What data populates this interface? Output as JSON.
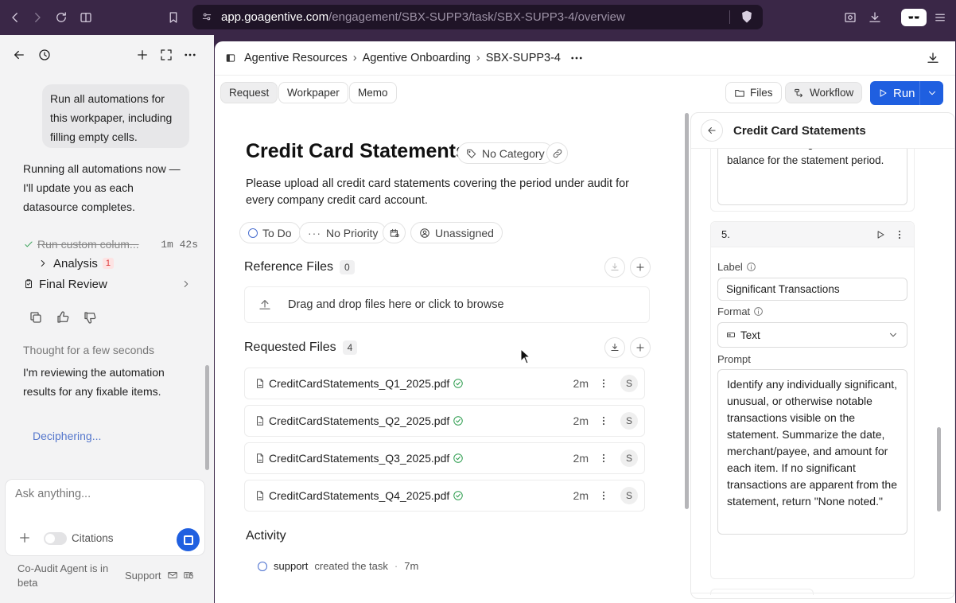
{
  "browser": {
    "url_domain": "app.goagentive.com",
    "url_path": "/engagement/SBX-SUPP3/task/SBX-SUPP3-4/overview"
  },
  "agent": {
    "user_message": "Run all automations for this workpaper, including filling empty cells.",
    "reply": "Running all automations now — I'll update you as each datasource completes.",
    "step_done": {
      "label": "Run custom colum...",
      "time": "1m 42s"
    },
    "analysis": {
      "label": "Analysis",
      "count": "1"
    },
    "final_review": "Final Review",
    "thought": "Thought for a few seconds",
    "reviewing": "I'm reviewing the automation results for any fixable items.",
    "status": "Deciphering...",
    "input_placeholder": "Ask anything...",
    "citations": "Citations",
    "beta_note": "Co-Audit Agent is in beta",
    "support": "Support"
  },
  "breadcrumb": {
    "items": [
      "Agentive Resources",
      "Agentive Onboarding",
      "SBX-SUPP3-4"
    ]
  },
  "tabs": [
    "Request",
    "Workpaper",
    "Memo"
  ],
  "toolbar": {
    "files": "Files",
    "workflow": "Workflow",
    "run": "Run"
  },
  "task": {
    "title": "Credit Card Statements",
    "category": "No Category",
    "description": "Please upload all credit card statements covering the period under audit for every company credit card account.",
    "status": "To Do",
    "priority": "No Priority",
    "assignee": "Unassigned"
  },
  "reference_files": {
    "title": "Reference Files",
    "count": "0",
    "dropzone": "Drag and drop files here or click to browse"
  },
  "requested_files": {
    "title": "Requested Files",
    "count": "4",
    "files": [
      {
        "name": "CreditCardStatements_Q1_2025.pdf",
        "age": "2m",
        "user": "S"
      },
      {
        "name": "CreditCardStatements_Q2_2025.pdf",
        "age": "2m",
        "user": "S"
      },
      {
        "name": "CreditCardStatements_Q3_2025.pdf",
        "age": "2m",
        "user": "S"
      },
      {
        "name": "CreditCardStatements_Q4_2025.pdf",
        "age": "2m",
        "user": "S"
      }
    ]
  },
  "activity": {
    "title": "Activity",
    "entry": {
      "user": "support",
      "action": "created the task",
      "time": "7m"
    }
  },
  "panel": {
    "title": "Credit Card Statements",
    "prev_prompt_tail": "Extract the ending balance or new balance for the statement period.",
    "item_number": "5.",
    "label_label": "Label",
    "label_value": "Significant Transactions",
    "format_label": "Format",
    "format_value": "Text",
    "prompt_label": "Prompt",
    "prompt_value": "Identify any individually significant, unusual, or otherwise notable transactions visible on the statement. Summarize the date, merchant/payee, and amount for each item. If no significant transactions are apparent from the statement, return \"None noted.\""
  },
  "colors": {
    "brand": "#1f5fe0",
    "chrome": "#3a2747",
    "success": "#2e9d4f"
  }
}
